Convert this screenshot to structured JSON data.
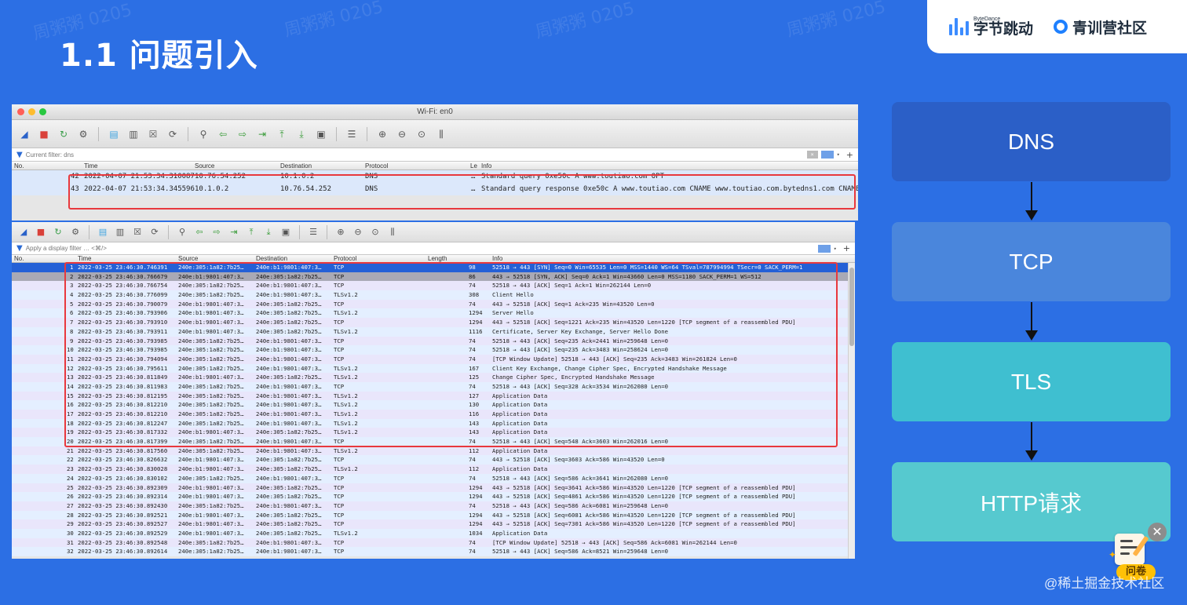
{
  "slide": {
    "title": "1.1 问题引入"
  },
  "brand": {
    "bytedance_small": "ByteDance",
    "bytedance_big": "字节跳动",
    "community": "青训营社区"
  },
  "watermark": "周粥粥 0205",
  "ws1": {
    "title": "Wi-Fi: en0",
    "filter": "Current filter: dns",
    "columns": [
      "No.",
      "Time",
      "Source",
      "Destination",
      "Protocol",
      "Le",
      "Info"
    ],
    "packets": [
      {
        "no": "42",
        "time": "2022-04-07 21:53:34.310087",
        "src": "10.76.54.252",
        "dst": "10.1.0.2",
        "proto": "DNS",
        "len": "…",
        "info": "Standard query 0xe50c A www.toutiao.com OPT"
      },
      {
        "no": "43",
        "time": "2022-04-07 21:53:34.345596",
        "src": "10.1.0.2",
        "dst": "10.76.54.252",
        "proto": "DNS",
        "len": "…",
        "info": "Standard query response 0xe50c A www.toutiao.com CNAME www.toutiao.com.bytedns1.com CNAME www"
      }
    ]
  },
  "ws2": {
    "filter": "Apply a display filter … <⌘/>",
    "columns": [
      "No.",
      "Time",
      "Source",
      "Destination",
      "Protocol",
      "Length",
      "Info"
    ],
    "packets": [
      {
        "no": "1",
        "time": "2022-03-25 23:46:30.746391",
        "src": "240e:305:1a82:7b25…",
        "dst": "240e:b1:9801:407:3…",
        "proto": "TCP",
        "len": "98",
        "info": "52518 → 443 [SYN] Seq=0 Win=65535 Len=0 MSS=1440 WS=64 TSval=787994994 TSecr=0 SACK_PERM=1"
      },
      {
        "no": "2",
        "time": "2022-03-25 23:46:30.766679",
        "src": "240e:b1:9801:407:3…",
        "dst": "240e:305:1a82:7b25…",
        "proto": "TCP",
        "len": "86",
        "info": "443 → 52518 [SYN, ACK] Seq=0 Ack=1 Win=43660 Len=0 MSS=1180 SACK_PERM=1 WS=512"
      },
      {
        "no": "3",
        "time": "2022-03-25 23:46:30.766754",
        "src": "240e:305:1a82:7b25…",
        "dst": "240e:b1:9801:407:3…",
        "proto": "TCP",
        "len": "74",
        "info": "52518 → 443 [ACK] Seq=1 Ack=1 Win=262144 Len=0"
      },
      {
        "no": "4",
        "time": "2022-03-25 23:46:30.776099",
        "src": "240e:305:1a82:7b25…",
        "dst": "240e:b1:9801:407:3…",
        "proto": "TLSv1.2",
        "len": "308",
        "info": "Client Hello"
      },
      {
        "no": "5",
        "time": "2022-03-25 23:46:30.790079",
        "src": "240e:b1:9801:407:3…",
        "dst": "240e:305:1a82:7b25…",
        "proto": "TCP",
        "len": "74",
        "info": "443 → 52518 [ACK] Seq=1 Ack=235 Win=43520 Len=0"
      },
      {
        "no": "6",
        "time": "2022-03-25 23:46:30.793906",
        "src": "240e:b1:9801:407:3…",
        "dst": "240e:305:1a82:7b25…",
        "proto": "TLSv1.2",
        "len": "1294",
        "info": "Server Hello"
      },
      {
        "no": "7",
        "time": "2022-03-25 23:46:30.793910",
        "src": "240e:b1:9801:407:3…",
        "dst": "240e:305:1a82:7b25…",
        "proto": "TCP",
        "len": "1294",
        "info": "443 → 52518 [ACK] Seq=1221 Ack=235 Win=43520 Len=1220 [TCP segment of a reassembled PDU]"
      },
      {
        "no": "8",
        "time": "2022-03-25 23:46:30.793911",
        "src": "240e:b1:9801:407:3…",
        "dst": "240e:305:1a82:7b25…",
        "proto": "TLSv1.2",
        "len": "1116",
        "info": "Certificate, Server Key Exchange, Server Hello Done"
      },
      {
        "no": "9",
        "time": "2022-03-25 23:46:30.793985",
        "src": "240e:305:1a82:7b25…",
        "dst": "240e:b1:9801:407:3…",
        "proto": "TCP",
        "len": "74",
        "info": "52518 → 443 [ACK] Seq=235 Ack=2441 Win=259648 Len=0"
      },
      {
        "no": "10",
        "time": "2022-03-25 23:46:30.793985",
        "src": "240e:305:1a82:7b25…",
        "dst": "240e:b1:9801:407:3…",
        "proto": "TCP",
        "len": "74",
        "info": "52518 → 443 [ACK] Seq=235 Ack=3483 Win=258624 Len=0"
      },
      {
        "no": "11",
        "time": "2022-03-25 23:46:30.794094",
        "src": "240e:305:1a82:7b25…",
        "dst": "240e:b1:9801:407:3…",
        "proto": "TCP",
        "len": "74",
        "info": "[TCP Window Update] 52518 → 443 [ACK] Seq=235 Ack=3483 Win=261824 Len=0"
      },
      {
        "no": "12",
        "time": "2022-03-25 23:46:30.795611",
        "src": "240e:305:1a82:7b25…",
        "dst": "240e:b1:9801:407:3…",
        "proto": "TLSv1.2",
        "len": "167",
        "info": "Client Key Exchange, Change Cipher Spec, Encrypted Handshake Message"
      },
      {
        "no": "13",
        "time": "2022-03-25 23:46:30.811849",
        "src": "240e:b1:9801:407:3…",
        "dst": "240e:305:1a82:7b25…",
        "proto": "TLSv1.2",
        "len": "125",
        "info": "Change Cipher Spec, Encrypted Handshake Message"
      },
      {
        "no": "14",
        "time": "2022-03-25 23:46:30.811983",
        "src": "240e:305:1a82:7b25…",
        "dst": "240e:b1:9801:407:3…",
        "proto": "TCP",
        "len": "74",
        "info": "52518 → 443 [ACK] Seq=328 Ack=3534 Win=262080 Len=0"
      },
      {
        "no": "15",
        "time": "2022-03-25 23:46:30.812195",
        "src": "240e:305:1a82:7b25…",
        "dst": "240e:b1:9801:407:3…",
        "proto": "TLSv1.2",
        "len": "127",
        "info": "Application Data"
      },
      {
        "no": "16",
        "time": "2022-03-25 23:46:30.812210",
        "src": "240e:305:1a82:7b25…",
        "dst": "240e:b1:9801:407:3…",
        "proto": "TLSv1.2",
        "len": "130",
        "info": "Application Data"
      },
      {
        "no": "17",
        "time": "2022-03-25 23:46:30.812210",
        "src": "240e:305:1a82:7b25…",
        "dst": "240e:b1:9801:407:3…",
        "proto": "TLSv1.2",
        "len": "116",
        "info": "Application Data"
      },
      {
        "no": "18",
        "time": "2022-03-25 23:46:30.812247",
        "src": "240e:305:1a82:7b25…",
        "dst": "240e:b1:9801:407:3…",
        "proto": "TLSv1.2",
        "len": "143",
        "info": "Application Data"
      },
      {
        "no": "19",
        "time": "2022-03-25 23:46:30.817332",
        "src": "240e:b1:9801:407:3…",
        "dst": "240e:305:1a82:7b25…",
        "proto": "TLSv1.2",
        "len": "143",
        "info": "Application Data"
      },
      {
        "no": "20",
        "time": "2022-03-25 23:46:30.817399",
        "src": "240e:305:1a82:7b25…",
        "dst": "240e:b1:9801:407:3…",
        "proto": "TCP",
        "len": "74",
        "info": "52518 → 443 [ACK] Seq=548 Ack=3603 Win=262016 Len=0"
      },
      {
        "no": "21",
        "time": "2022-03-25 23:46:30.817560",
        "src": "240e:305:1a82:7b25…",
        "dst": "240e:b1:9801:407:3…",
        "proto": "TLSv1.2",
        "len": "112",
        "info": "Application Data"
      },
      {
        "no": "22",
        "time": "2022-03-25 23:46:30.826632",
        "src": "240e:b1:9801:407:3…",
        "dst": "240e:305:1a82:7b25…",
        "proto": "TCP",
        "len": "74",
        "info": "443 → 52518 [ACK] Seq=3603 Ack=586 Win=43520 Len=0"
      },
      {
        "no": "23",
        "time": "2022-03-25 23:46:30.830028",
        "src": "240e:b1:9801:407:3…",
        "dst": "240e:305:1a82:7b25…",
        "proto": "TLSv1.2",
        "len": "112",
        "info": "Application Data"
      },
      {
        "no": "24",
        "time": "2022-03-25 23:46:30.830102",
        "src": "240e:305:1a82:7b25…",
        "dst": "240e:b1:9801:407:3…",
        "proto": "TCP",
        "len": "74",
        "info": "52518 → 443 [ACK] Seq=586 Ack=3641 Win=262080 Len=0"
      },
      {
        "no": "25",
        "time": "2022-03-25 23:46:30.892309",
        "src": "240e:b1:9801:407:3…",
        "dst": "240e:305:1a82:7b25…",
        "proto": "TCP",
        "len": "1294",
        "info": "443 → 52518 [ACK] Seq=3641 Ack=586 Win=43520 Len=1220 [TCP segment of a reassembled PDU]"
      },
      {
        "no": "26",
        "time": "2022-03-25 23:46:30.892314",
        "src": "240e:b1:9801:407:3…",
        "dst": "240e:305:1a82:7b25…",
        "proto": "TCP",
        "len": "1294",
        "info": "443 → 52518 [ACK] Seq=4861 Ack=586 Win=43520 Len=1220 [TCP segment of a reassembled PDU]"
      },
      {
        "no": "27",
        "time": "2022-03-25 23:46:30.892430",
        "src": "240e:305:1a82:7b25…",
        "dst": "240e:b1:9801:407:3…",
        "proto": "TCP",
        "len": "74",
        "info": "52518 → 443 [ACK] Seq=586 Ack=6081 Win=259648 Len=0"
      },
      {
        "no": "28",
        "time": "2022-03-25 23:46:30.892521",
        "src": "240e:b1:9801:407:3…",
        "dst": "240e:305:1a82:7b25…",
        "proto": "TCP",
        "len": "1294",
        "info": "443 → 52518 [ACK] Seq=6081 Ack=586 Win=43520 Len=1220 [TCP segment of a reassembled PDU]"
      },
      {
        "no": "29",
        "time": "2022-03-25 23:46:30.892527",
        "src": "240e:b1:9801:407:3…",
        "dst": "240e:305:1a82:7b25…",
        "proto": "TCP",
        "len": "1294",
        "info": "443 → 52518 [ACK] Seq=7301 Ack=586 Win=43520 Len=1220 [TCP segment of a reassembled PDU]"
      },
      {
        "no": "30",
        "time": "2022-03-25 23:46:30.892529",
        "src": "240e:b1:9801:407:3…",
        "dst": "240e:305:1a82:7b25…",
        "proto": "TLSv1.2",
        "len": "1034",
        "info": "Application Data"
      },
      {
        "no": "31",
        "time": "2022-03-25 23:46:30.892548",
        "src": "240e:305:1a82:7b25…",
        "dst": "240e:b1:9801:407:3…",
        "proto": "TCP",
        "len": "74",
        "info": "[TCP Window Update] 52518 → 443 [ACK] Seq=586 Ack=6081 Win=262144 Len=0"
      },
      {
        "no": "32",
        "time": "2022-03-25 23:46:30.892614",
        "src": "240e:305:1a82:7b25…",
        "dst": "240e:b1:9801:407:3…",
        "proto": "TCP",
        "len": "74",
        "info": "52518 → 443 [ACK] Seq=586 Ack=8521 Win=259648 Len=0"
      }
    ]
  },
  "flow": {
    "steps": [
      {
        "label": "DNS",
        "color": "#2b5fc7"
      },
      {
        "label": "TCP",
        "color": "#4a86dc"
      },
      {
        "label": "TLS",
        "color": "#3fbfd0"
      },
      {
        "label": "HTTP请求",
        "color": "#56c9cf"
      }
    ]
  },
  "survey": {
    "label": "问卷",
    "close": "✕"
  },
  "juejin": "@稀土掘金技术社区",
  "colors": {
    "background": "#2c6fe4",
    "highlight_box": "#e8383d",
    "selected_row": "#2460d6"
  }
}
